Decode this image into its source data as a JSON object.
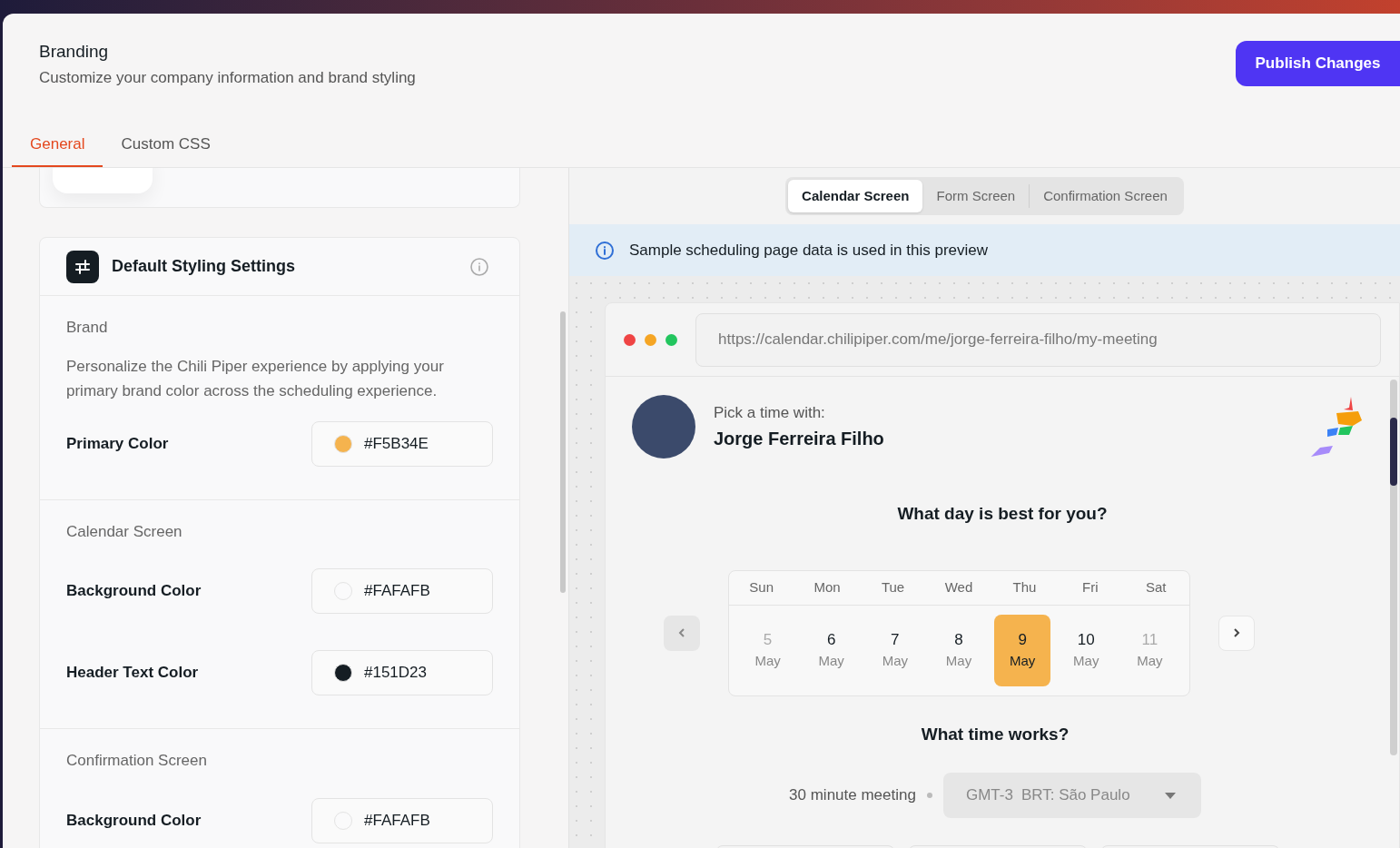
{
  "header": {
    "title": "Branding",
    "subtitle": "Customize your company information and brand styling",
    "publish_button": "Publish Changes"
  },
  "tabs": [
    {
      "label": "General",
      "selected": true
    },
    {
      "label": "Custom CSS",
      "selected": false
    }
  ],
  "styling_card": {
    "title": "Default Styling Settings",
    "sections": [
      {
        "heading": "Brand",
        "description": "Personalize the Chili Piper experience by applying your primary brand color across the scheduling experience.",
        "fields": [
          {
            "label": "Primary Color",
            "value": "#F5B34E",
            "color": "#f5b34e"
          }
        ]
      },
      {
        "heading": "Calendar Screen",
        "fields": [
          {
            "label": "Background Color",
            "value": "#FAFAFB",
            "color": "#fafafb"
          },
          {
            "label": "Header Text Color",
            "value": "#151D23",
            "color": "#151d23"
          }
        ]
      },
      {
        "heading": "Confirmation Screen",
        "fields": [
          {
            "label": "Background Color",
            "value": "#FAFAFB",
            "color": "#fafafb"
          }
        ]
      }
    ]
  },
  "preview": {
    "screen_tabs": [
      {
        "label": "Calendar Screen",
        "selected": true
      },
      {
        "label": "Form Screen",
        "selected": false
      },
      {
        "label": "Confirmation Screen",
        "selected": false
      }
    ],
    "notice": "Sample scheduling page data is used in this preview",
    "url": "https://calendar.chilipiper.com/me/jorge-ferreira-filho/my-meeting",
    "host_label": "Pick a time with:",
    "host_name": "Jorge Ferreira Filho",
    "day_question": "What day is best for you?",
    "weekdays": [
      "Sun",
      "Mon",
      "Tue",
      "Wed",
      "Thu",
      "Fri",
      "Sat"
    ],
    "days": [
      {
        "day": "5",
        "month": "May",
        "disabled": true,
        "selected": false
      },
      {
        "day": "6",
        "month": "May",
        "disabled": false,
        "selected": false
      },
      {
        "day": "7",
        "month": "May",
        "disabled": false,
        "selected": false
      },
      {
        "day": "8",
        "month": "May",
        "disabled": false,
        "selected": false
      },
      {
        "day": "9",
        "month": "May",
        "disabled": false,
        "selected": true
      },
      {
        "day": "10",
        "month": "May",
        "disabled": false,
        "selected": false
      },
      {
        "day": "11",
        "month": "May",
        "disabled": true,
        "selected": false
      }
    ],
    "time_question": "What time works?",
    "meeting_length": "30 minute meeting",
    "timezone_offset": "GMT-3",
    "timezone_name": "BRT: São Paulo"
  }
}
